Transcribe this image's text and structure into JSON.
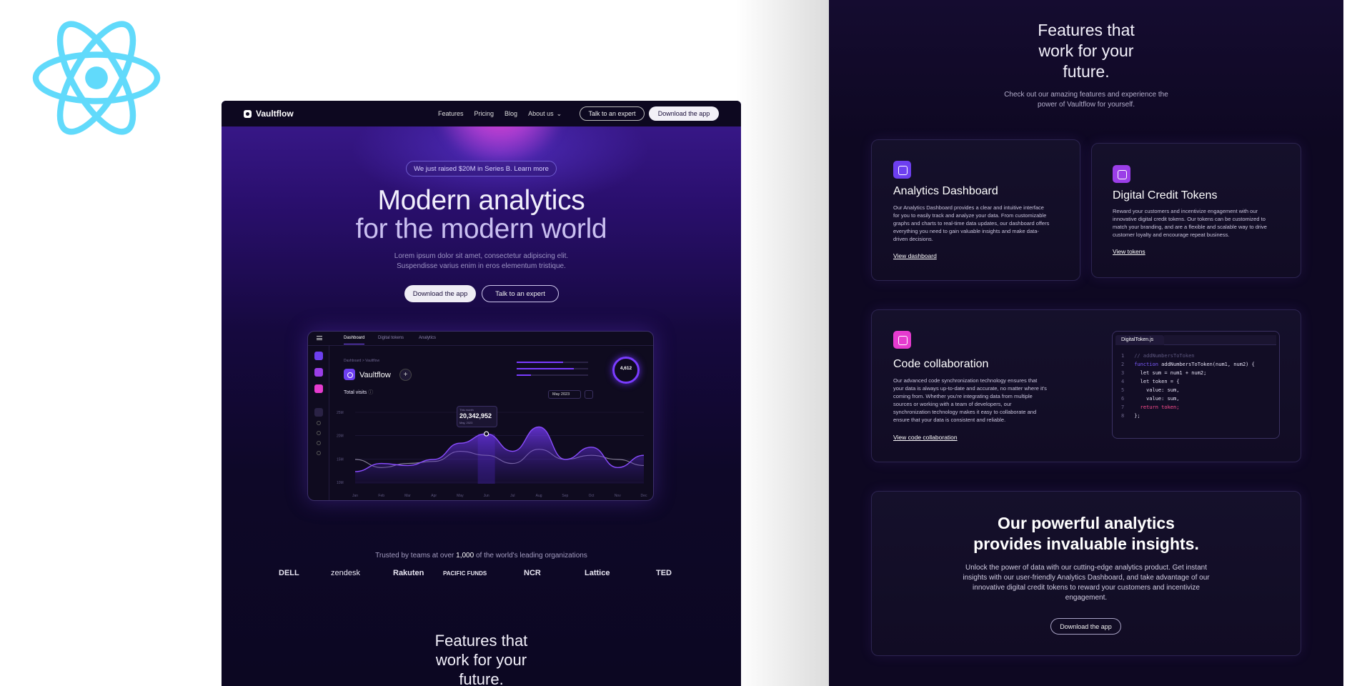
{
  "colors": {
    "accent": "#7a3cff",
    "pink": "#e63bcf",
    "react": "#61dafb",
    "bg_dark": "#0e0822"
  },
  "react_logo": {
    "icon": "react-icon"
  },
  "left": {
    "nav": {
      "brand": "Vaultflow",
      "links": [
        "Features",
        "Pricing",
        "Blog",
        "About us"
      ],
      "talk": "Talk to an expert",
      "download": "Download the app"
    },
    "hero": {
      "announcement": "We just raised $20M in Series B. Learn more",
      "title_line1": "Modern analytics",
      "title_line2": "for the modern world",
      "sub_line1": "Lorem ipsum dolor sit amet, consectetur adipiscing elit.",
      "sub_line2": "Suspendisse varius enim in eros elementum tristique.",
      "primary": "Download the app",
      "secondary": "Talk to an expert"
    },
    "dashboard": {
      "tabs": [
        "Dashboard",
        "Digital tokens",
        "Analytics"
      ],
      "breadcrumb": "Dashboard  >  Vaultflow",
      "name": "Vaultflow",
      "plus": "+",
      "total_visits": "Total visits",
      "date": "May 2023",
      "ring_value": "4,612",
      "tooltip_label": "This month",
      "tooltip_value": "20,342,952",
      "tooltip_date": "May, 2023",
      "stat_bars": [
        {
          "value": 0.65
        },
        {
          "value": 0.8
        },
        {
          "value": 0.2
        }
      ]
    },
    "trusted": {
      "prefix": "Trusted by teams at over ",
      "count": "1,000",
      "suffix": " of the world's leading organizations"
    },
    "logos": [
      "DELL",
      "zendesk",
      "Rakuten",
      "PACIFIC FUNDS",
      "NCR",
      "Lattice",
      "TED"
    ],
    "features": {
      "line1": "Features that",
      "line2": "work for your",
      "line3": "future."
    }
  },
  "right": {
    "title_line1": "Features that",
    "title_line2": "work for your",
    "title_line3": "future.",
    "sub_line1": "Check out our amazing features and experience the",
    "sub_line2": "power of Vaultflow for yourself.",
    "cards": [
      {
        "title": "Analytics Dashboard",
        "icon": "chart-icon",
        "desc": [
          "Our Analytics Dashboard provides a clear and intuitive interface",
          "for you to easily track and analyze your data. From customizable",
          "graphs and charts to real-time data updates, our dashboard offers",
          "everything you need to gain valuable insights and make data-",
          "driven decisions."
        ],
        "link": "View dashboard"
      },
      {
        "title": "Digital Credit Tokens",
        "icon": "token-icon",
        "desc": [
          "Reward your customers and incentivize engagement with our",
          "innovative digital credit tokens. Our tokens can be customized to",
          "match your branding, and are a flexible and scalable way to drive",
          "customer loyalty and encourage repeat business."
        ],
        "link": "View tokens"
      },
      {
        "title": "Code collaboration",
        "icon": "code-icon",
        "desc": [
          "Our advanced code synchronization technology ensures that",
          "your data is always up-to-date and accurate, no matter where it's",
          "coming from. Whether you're integrating data from multiple",
          "sources or working with a team of developers, our",
          "synchronization technology makes it easy to collaborate and",
          "ensure that your data is consistent and reliable."
        ],
        "link": "View code collaboration"
      }
    ],
    "code": {
      "file": "DigitalToken.js",
      "lines": [
        "// addNumbersToToken",
        "function addNumbersToToken(num1, num2) {",
        "  let sum = num1 + num2;",
        "  let token = {",
        "    value: sum,",
        "    value: sum,",
        "  return token;",
        "};"
      ]
    },
    "analytics": {
      "title_line1": "Our powerful analytics",
      "title_line2": "provides invaluable insights.",
      "desc": [
        "Unlock the power of data with our cutting-edge analytics product. Get instant",
        "insights with our user-friendly Analytics Dashboard, and take advantage of our",
        "innovative digital credit tokens to reward your customers and incentivize",
        "engagement."
      ],
      "button": "Download the app"
    }
  },
  "chart_data": {
    "type": "area",
    "x": [
      "Jan",
      "Feb",
      "Mar",
      "Apr",
      "May",
      "Jun",
      "Jul",
      "Aug",
      "Sep",
      "Oct",
      "Nov",
      "Dec"
    ],
    "yticks": [
      "25M",
      "20M",
      "15M",
      "10M"
    ],
    "ylim": [
      8,
      27
    ],
    "series": [
      {
        "name": "",
        "values": [
          11,
          13,
          12.5,
          14,
          18,
          20.3,
          16,
          22,
          14,
          17,
          12,
          15
        ]
      },
      {
        "name": "",
        "values": [
          14,
          12,
          13,
          13.5,
          16,
          15,
          13,
          16.5,
          14,
          15,
          14,
          12.5
        ]
      }
    ],
    "highlight_index": 5,
    "grid": true
  }
}
